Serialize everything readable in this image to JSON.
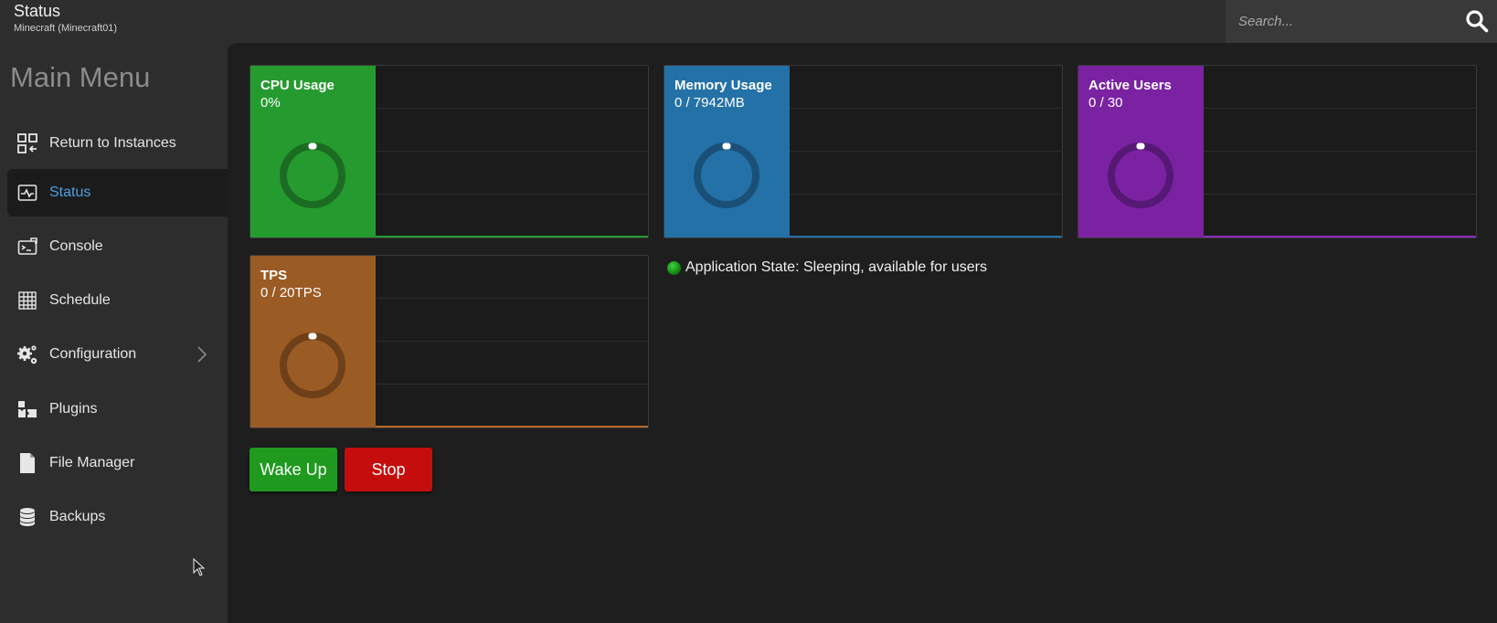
{
  "header": {
    "title": "Status",
    "subtitle": "Minecraft (Minecraft01)",
    "search_placeholder": "Search..."
  },
  "sidebar": {
    "heading": "Main Menu",
    "items": [
      {
        "label": "Return to Instances",
        "icon": "instances-icon"
      },
      {
        "label": "Status",
        "icon": "status-icon",
        "active": true
      },
      {
        "label": "Console",
        "icon": "console-icon"
      },
      {
        "label": "Schedule",
        "icon": "schedule-icon"
      },
      {
        "label": "Configuration",
        "icon": "gear-icon",
        "has_submenu": true
      },
      {
        "label": "Plugins",
        "icon": "plugins-icon"
      },
      {
        "label": "File Manager",
        "icon": "file-icon"
      },
      {
        "label": "Backups",
        "icon": "database-icon"
      }
    ]
  },
  "stats": {
    "cpu": {
      "label": "CPU Usage",
      "value": "0%",
      "color": "#259b2f",
      "level": 0
    },
    "memory": {
      "label": "Memory Usage",
      "value": "0 / 7942MB",
      "color": "#2471a8",
      "level": 0
    },
    "users": {
      "label": "Active Users",
      "value": "0 / 30",
      "color": "#7b22a3",
      "level": 0
    },
    "tps": {
      "label": "TPS",
      "value": "0 / 20TPS",
      "color": "#9b5b24",
      "level": 0
    }
  },
  "app_state": {
    "text": "Application State: Sleeping, available for users",
    "status_color": "#22a722"
  },
  "actions": {
    "wake_label": "Wake Up",
    "stop_label": "Stop"
  }
}
